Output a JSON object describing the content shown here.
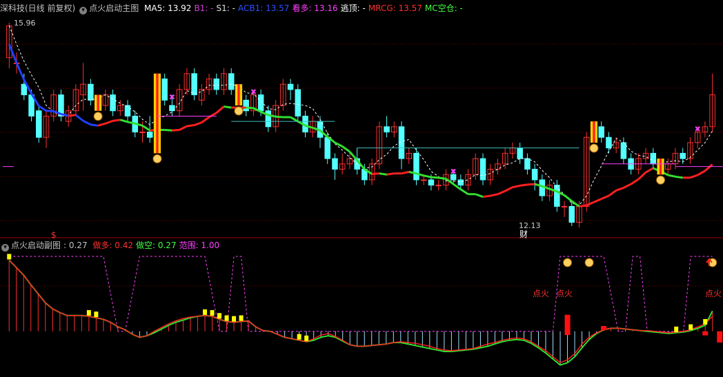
{
  "main_header": {
    "stock": "深科技(日线 前复权)",
    "indicator": "点火启动主图",
    "items": [
      {
        "label": "MA5:",
        "value": "13.92",
        "color": "#ffffff"
      },
      {
        "label": "B1:",
        "value": "-",
        "color": "#d040d0"
      },
      {
        "label": "S1:",
        "value": "-",
        "color": "#e0e0e0"
      },
      {
        "label": "ACB1:",
        "value": "13.57",
        "color": "#3050ff"
      },
      {
        "label": "看多:",
        "value": "13.16",
        "color": "#ff40ff"
      },
      {
        "label": "逃顶:",
        "value": "-",
        "color": "#ffffff"
      },
      {
        "label": "MRCG:",
        "value": "13.57",
        "color": "#ff3030"
      },
      {
        "label": "MC空仓:",
        "value": "-",
        "color": "#40ff40"
      }
    ]
  },
  "sub_header": {
    "indicator": "点火启动副图",
    "value": ": 0.27",
    "items": [
      {
        "label": "做多:",
        "value": "0.42",
        "color": "#ff3030"
      },
      {
        "label": "做空:",
        "value": "0.27",
        "color": "#40ff40"
      },
      {
        "label": "范围:",
        "value": "1.00",
        "color": "#ff40ff"
      }
    ]
  },
  "annotations": {
    "high_price": "15.96",
    "low_price": "12.13",
    "low_tag": "财",
    "dollar_mark": "$",
    "signal_label": "点火"
  },
  "colors": {
    "up": "#ff3030",
    "down": "#54ffff",
    "ma": "#ffffff",
    "green_line": "#30e030",
    "red_line": "#ff2020",
    "blue_line": "#2040ff",
    "magenta": "#ff40ff",
    "cyan_level": "#40c0c0",
    "grid": "#800000"
  },
  "chart_data": [
    {
      "type": "candlestick",
      "title": "点火启动主图",
      "price_range": [
        12.0,
        16.1
      ],
      "candles": [
        [
          15.3,
          15.9,
          15.96,
          15.1
        ],
        [
          15.2,
          15.2,
          15.4,
          15.0
        ],
        [
          14.8,
          14.6,
          15.0,
          14.5
        ],
        [
          14.6,
          14.2,
          14.7,
          14.1
        ],
        [
          14.3,
          13.8,
          14.4,
          13.7
        ],
        [
          13.8,
          14.2,
          14.3,
          13.6
        ],
        [
          14.2,
          14.6,
          14.7,
          14.1
        ],
        [
          14.6,
          14.2,
          14.7,
          14.1
        ],
        [
          14.1,
          14.3,
          14.4,
          14.0
        ],
        [
          14.3,
          14.7,
          14.8,
          14.2
        ],
        [
          14.6,
          14.8,
          15.2,
          14.3
        ],
        [
          14.8,
          14.5,
          14.9,
          14.4
        ],
        [
          14.5,
          14.4,
          14.6,
          14.3
        ],
        [
          14.4,
          14.6,
          14.7,
          14.3
        ],
        [
          14.6,
          14.3,
          14.7,
          14.2
        ],
        [
          14.3,
          14.4,
          14.5,
          14.2
        ],
        [
          14.4,
          14.2,
          14.5,
          14.1
        ],
        [
          14.2,
          13.9,
          14.3,
          13.8
        ],
        [
          13.9,
          13.9,
          14.1,
          13.7
        ],
        [
          13.9,
          13.8,
          14.2,
          13.7
        ],
        [
          13.8,
          14.9,
          15.0,
          13.5
        ],
        [
          14.9,
          14.5,
          15.0,
          14.4
        ],
        [
          14.4,
          14.3,
          14.6,
          14.2
        ],
        [
          14.3,
          14.7,
          14.8,
          14.2
        ],
        [
          14.7,
          15.0,
          15.1,
          14.6
        ],
        [
          15.0,
          14.6,
          15.1,
          14.5
        ],
        [
          14.5,
          14.7,
          14.8,
          14.4
        ],
        [
          14.7,
          14.9,
          15.0,
          14.6
        ],
        [
          14.9,
          14.7,
          15.0,
          14.6
        ],
        [
          14.7,
          15.0,
          15.1,
          14.6
        ],
        [
          15.0,
          14.7,
          15.1,
          14.6
        ],
        [
          14.7,
          14.5,
          14.8,
          14.4
        ],
        [
          14.5,
          14.3,
          14.6,
          14.2
        ],
        [
          14.3,
          14.6,
          14.7,
          14.2
        ],
        [
          14.6,
          14.3,
          14.7,
          14.2
        ],
        [
          14.3,
          14.0,
          14.4,
          13.9
        ],
        [
          14.0,
          14.4,
          14.5,
          13.9
        ],
        [
          14.4,
          14.8,
          14.9,
          14.3
        ],
        [
          14.8,
          14.7,
          14.9,
          14.5
        ],
        [
          14.7,
          14.2,
          14.8,
          14.1
        ],
        [
          14.2,
          13.9,
          14.3,
          13.8
        ],
        [
          13.9,
          14.1,
          14.2,
          13.8
        ],
        [
          14.1,
          13.8,
          14.2,
          13.6
        ],
        [
          13.8,
          13.4,
          13.9,
          13.3
        ],
        [
          13.4,
          13.2,
          13.5,
          13.0
        ],
        [
          13.2,
          13.3,
          13.5,
          13.1
        ],
        [
          13.3,
          13.4,
          13.5,
          13.2
        ],
        [
          13.4,
          13.2,
          13.6,
          13.1
        ],
        [
          13.2,
          13.0,
          13.3,
          12.9
        ],
        [
          13.0,
          13.3,
          13.4,
          12.9
        ],
        [
          13.3,
          14.0,
          14.1,
          13.2
        ],
        [
          14.0,
          13.9,
          14.2,
          13.8
        ],
        [
          13.9,
          14.0,
          14.1,
          13.8
        ],
        [
          14.0,
          13.4,
          14.1,
          13.2
        ],
        [
          13.4,
          13.5,
          13.6,
          13.3
        ],
        [
          13.5,
          13.0,
          13.6,
          12.9
        ],
        [
          13.0,
          13.0,
          13.1,
          12.9
        ],
        [
          13.0,
          12.9,
          13.1,
          12.8
        ],
        [
          12.9,
          12.9,
          13.0,
          12.8
        ],
        [
          12.9,
          13.1,
          13.2,
          12.8
        ],
        [
          13.1,
          13.0,
          13.2,
          12.9
        ],
        [
          13.0,
          12.9,
          13.1,
          12.8
        ],
        [
          12.9,
          13.1,
          13.2,
          12.8
        ],
        [
          13.1,
          13.4,
          13.5,
          13.0
        ],
        [
          13.4,
          13.0,
          13.5,
          12.9
        ],
        [
          13.0,
          13.2,
          13.3,
          12.9
        ],
        [
          13.2,
          13.3,
          13.4,
          13.1
        ],
        [
          13.3,
          13.5,
          13.6,
          13.2
        ],
        [
          13.5,
          13.6,
          13.7,
          13.4
        ],
        [
          13.6,
          13.4,
          13.7,
          13.3
        ],
        [
          13.4,
          13.2,
          13.5,
          13.1
        ],
        [
          13.2,
          13.0,
          13.3,
          12.8
        ],
        [
          13.0,
          12.7,
          13.1,
          12.6
        ],
        [
          12.7,
          12.9,
          13.0,
          12.6
        ],
        [
          12.9,
          12.5,
          13.0,
          12.4
        ],
        [
          12.5,
          12.5,
          12.6,
          12.3
        ],
        [
          12.5,
          12.2,
          12.6,
          12.13
        ],
        [
          12.2,
          12.5,
          12.6,
          12.1
        ],
        [
          12.5,
          13.8,
          13.9,
          12.4
        ],
        [
          13.8,
          14.0,
          14.1,
          13.7
        ],
        [
          14.0,
          13.8,
          14.1,
          13.7
        ],
        [
          13.8,
          13.6,
          13.9,
          13.5
        ],
        [
          13.6,
          13.7,
          13.8,
          13.5
        ],
        [
          13.7,
          13.4,
          13.8,
          13.3
        ],
        [
          13.4,
          13.2,
          13.5,
          13.1
        ],
        [
          13.2,
          13.4,
          13.5,
          13.1
        ],
        [
          13.4,
          13.5,
          13.6,
          13.3
        ],
        [
          13.5,
          13.3,
          13.6,
          13.2
        ],
        [
          13.3,
          13.2,
          13.4,
          13.1
        ],
        [
          13.2,
          13.3,
          13.4,
          13.1
        ],
        [
          13.3,
          13.5,
          13.6,
          13.2
        ],
        [
          13.5,
          13.4,
          13.6,
          13.3
        ],
        [
          13.4,
          13.7,
          13.8,
          13.3
        ],
        [
          13.7,
          13.9,
          14.0,
          13.6
        ],
        [
          13.9,
          14.0,
          14.1,
          13.8
        ],
        [
          14.0,
          14.6,
          15.0,
          13.9
        ]
      ]
    },
    {
      "type": "line",
      "title": "点火启动副图",
      "y_range": [
        -0.5,
        1.0
      ],
      "series": [
        {
          "name": "做多",
          "values": [
            0.95,
            0.85,
            0.75,
            0.62,
            0.5,
            0.38,
            0.3,
            0.25,
            0.21,
            0.21,
            0.21,
            0.2,
            0.18,
            0.16,
            0.12,
            0.06,
            0.02,
            -0.04,
            -0.08,
            -0.06,
            0.0,
            0.05,
            0.1,
            0.14,
            0.17,
            0.19,
            0.2,
            0.21,
            0.2,
            0.16,
            0.13,
            0.12,
            0.13,
            0.14,
            0.06,
            0.01,
            0.0,
            -0.04,
            -0.08,
            -0.1,
            -0.12,
            -0.14,
            -0.1,
            -0.05,
            -0.03,
            -0.07,
            -0.12,
            -0.18,
            -0.2,
            -0.2,
            -0.19,
            -0.18,
            -0.17,
            -0.15,
            -0.14,
            -0.15,
            -0.16,
            -0.18,
            -0.2,
            -0.23,
            -0.25,
            -0.26,
            -0.25,
            -0.24,
            -0.23,
            -0.2,
            -0.17,
            -0.15,
            -0.12,
            -0.1,
            -0.09,
            -0.1,
            -0.14,
            -0.2,
            -0.26,
            -0.34,
            -0.42,
            -0.38,
            -0.3,
            -0.17,
            -0.08,
            -0.02,
            0.02,
            0.04,
            0.04,
            0.03,
            0.02,
            0.01,
            0.01,
            0.0,
            -0.01,
            -0.02,
            -0.01,
            0.0,
            0.02,
            0.06,
            0.1,
            0.2
          ]
        },
        {
          "name": "做空",
          "values": [
            0.95,
            0.85,
            0.75,
            0.62,
            0.5,
            0.38,
            0.3,
            0.25,
            0.21,
            0.21,
            0.21,
            0.2,
            0.18,
            0.16,
            0.12,
            0.06,
            0.02,
            -0.04,
            -0.08,
            -0.06,
            -0.02,
            0.03,
            0.08,
            0.12,
            0.15,
            0.18,
            0.2,
            0.21,
            0.2,
            0.16,
            0.13,
            0.12,
            0.13,
            0.14,
            0.06,
            0.01,
            0.0,
            -0.04,
            -0.08,
            -0.1,
            -0.12,
            -0.14,
            -0.12,
            -0.08,
            -0.06,
            -0.08,
            -0.13,
            -0.18,
            -0.2,
            -0.2,
            -0.19,
            -0.18,
            -0.17,
            -0.15,
            -0.15,
            -0.17,
            -0.19,
            -0.21,
            -0.23,
            -0.25,
            -0.27,
            -0.27,
            -0.26,
            -0.25,
            -0.24,
            -0.22,
            -0.2,
            -0.17,
            -0.14,
            -0.12,
            -0.11,
            -0.12,
            -0.16,
            -0.22,
            -0.29,
            -0.37,
            -0.45,
            -0.42,
            -0.34,
            -0.22,
            -0.11,
            -0.03,
            0.02,
            0.04,
            0.04,
            0.03,
            0.02,
            0.01,
            0.0,
            -0.01,
            -0.02,
            -0.03,
            -0.02,
            -0.01,
            0.01,
            0.04,
            0.08,
            0.27
          ]
        },
        {
          "name": "范围",
          "values": [
            1.0,
            1.0,
            1.0,
            1.0,
            1.0,
            1.0,
            1.0,
            1.0,
            1.0,
            1.0,
            1.0,
            1.0,
            1.0,
            1.0,
            0.5,
            0.0,
            0.0,
            0.5,
            1.0,
            1.0,
            1.0,
            1.0,
            1.0,
            1.0,
            1.0,
            1.0,
            1.0,
            1.0,
            0.5,
            0.0,
            0.0,
            1.0,
            1.0,
            0.0,
            0.0,
            0.0,
            0.0,
            0.0,
            0.0,
            0.0,
            0.0,
            0.0,
            0.0,
            0.0,
            0.0,
            0.0,
            0.0,
            0.0,
            0.0,
            0.0,
            0.0,
            0.0,
            0.0,
            0.0,
            0.0,
            0.0,
            0.0,
            0.0,
            0.0,
            0.0,
            0.0,
            0.0,
            0.0,
            0.0,
            0.0,
            0.0,
            0.0,
            0.0,
            0.0,
            0.0,
            0.0,
            0.0,
            0.0,
            0.0,
            0.0,
            0.0,
            1.0,
            1.0,
            1.0,
            1.0,
            1.0,
            1.0,
            1.0,
            0.5,
            0.0,
            0.0,
            1.0,
            1.0,
            0.0,
            0.0,
            0.0,
            0.0,
            0.0,
            0.0,
            1.0,
            1.0,
            1.0,
            1.0
          ]
        }
      ]
    }
  ]
}
